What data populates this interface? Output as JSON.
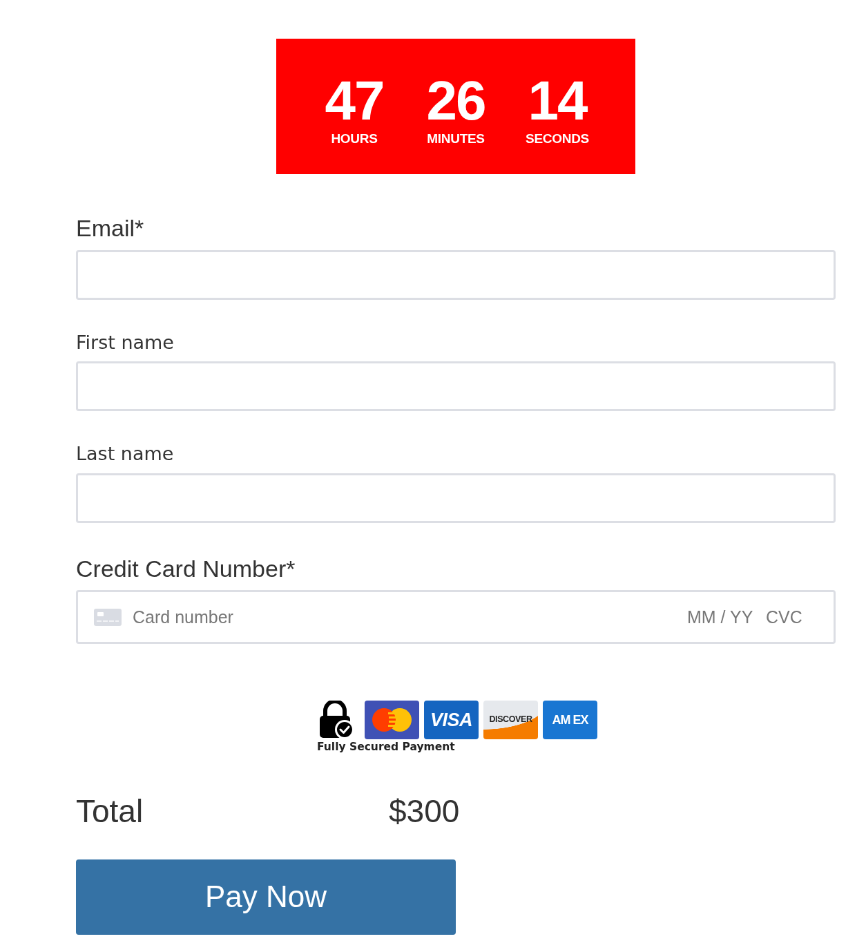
{
  "countdown": {
    "units": [
      {
        "value": "47",
        "unit": "HOURS"
      },
      {
        "value": "26",
        "unit": "MINUTES"
      },
      {
        "value": "14",
        "unit": "SECONDS"
      }
    ]
  },
  "form": {
    "fields": [
      {
        "kind": "text",
        "label": "Email*",
        "required": true
      },
      {
        "kind": "text",
        "label": "First name",
        "required": false
      },
      {
        "kind": "text",
        "label": "Last name",
        "required": false
      },
      {
        "kind": "card",
        "label": "Credit Card Number*",
        "required": true,
        "placeholder": "Card number",
        "expiry_placeholder": "MM / YY",
        "cvc_placeholder": "CVC"
      }
    ]
  },
  "secure_badge": {
    "caption": "Fully Secured Payment",
    "cards": [
      {
        "kind": "mastercard"
      },
      {
        "kind": "visa",
        "label": "VISA"
      },
      {
        "kind": "discover",
        "label": "DISCOVER"
      },
      {
        "kind": "amex",
        "label": "AM EX"
      }
    ]
  },
  "total": {
    "label": "Total",
    "amount": "$300"
  },
  "pay_button": {
    "label": "Pay Now"
  }
}
